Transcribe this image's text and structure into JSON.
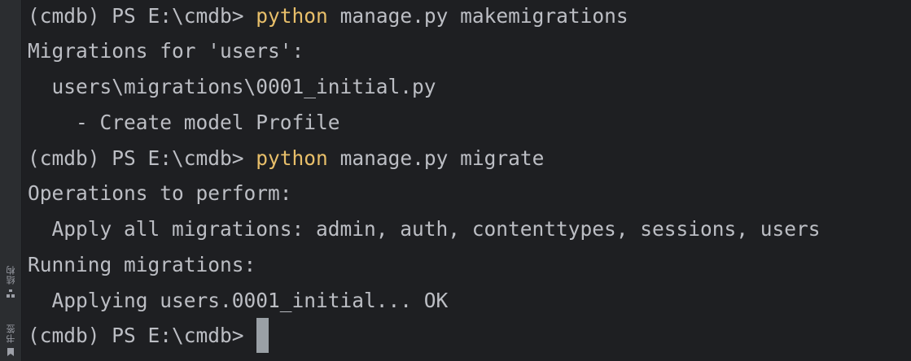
{
  "sidebar": {
    "structure_label": "结构",
    "bookmarks_label": "书签",
    "structure_icon": "structure-icon",
    "bookmarks_icon": "bookmark-icon"
  },
  "terminal": {
    "prompt": "(cmdb) PS E:\\cmdb>",
    "lines": [
      {
        "prompt": "(cmdb) PS E:\\cmdb>",
        "command": "python",
        "args": "manage.py makemigrations"
      },
      {
        "text": "Migrations for 'users':"
      },
      {
        "text": "  users\\migrations\\0001_initial.py"
      },
      {
        "text": "    - Create model Profile"
      },
      {
        "prompt": "(cmdb) PS E:\\cmdb>",
        "command": "python",
        "args": "manage.py migrate"
      },
      {
        "text": "Operations to perform:"
      },
      {
        "text": "  Apply all migrations: admin, auth, contenttypes, sessions, users"
      },
      {
        "text": "Running migrations:"
      },
      {
        "text": "  Applying users.0001_initial... OK"
      },
      {
        "prompt": "(cmdb) PS E:\\cmdb>"
      }
    ]
  },
  "colors": {
    "background": "#1e1f22",
    "text": "#bcbec4",
    "command": "#e8bf6a",
    "cursor": "#9aa0a6"
  }
}
